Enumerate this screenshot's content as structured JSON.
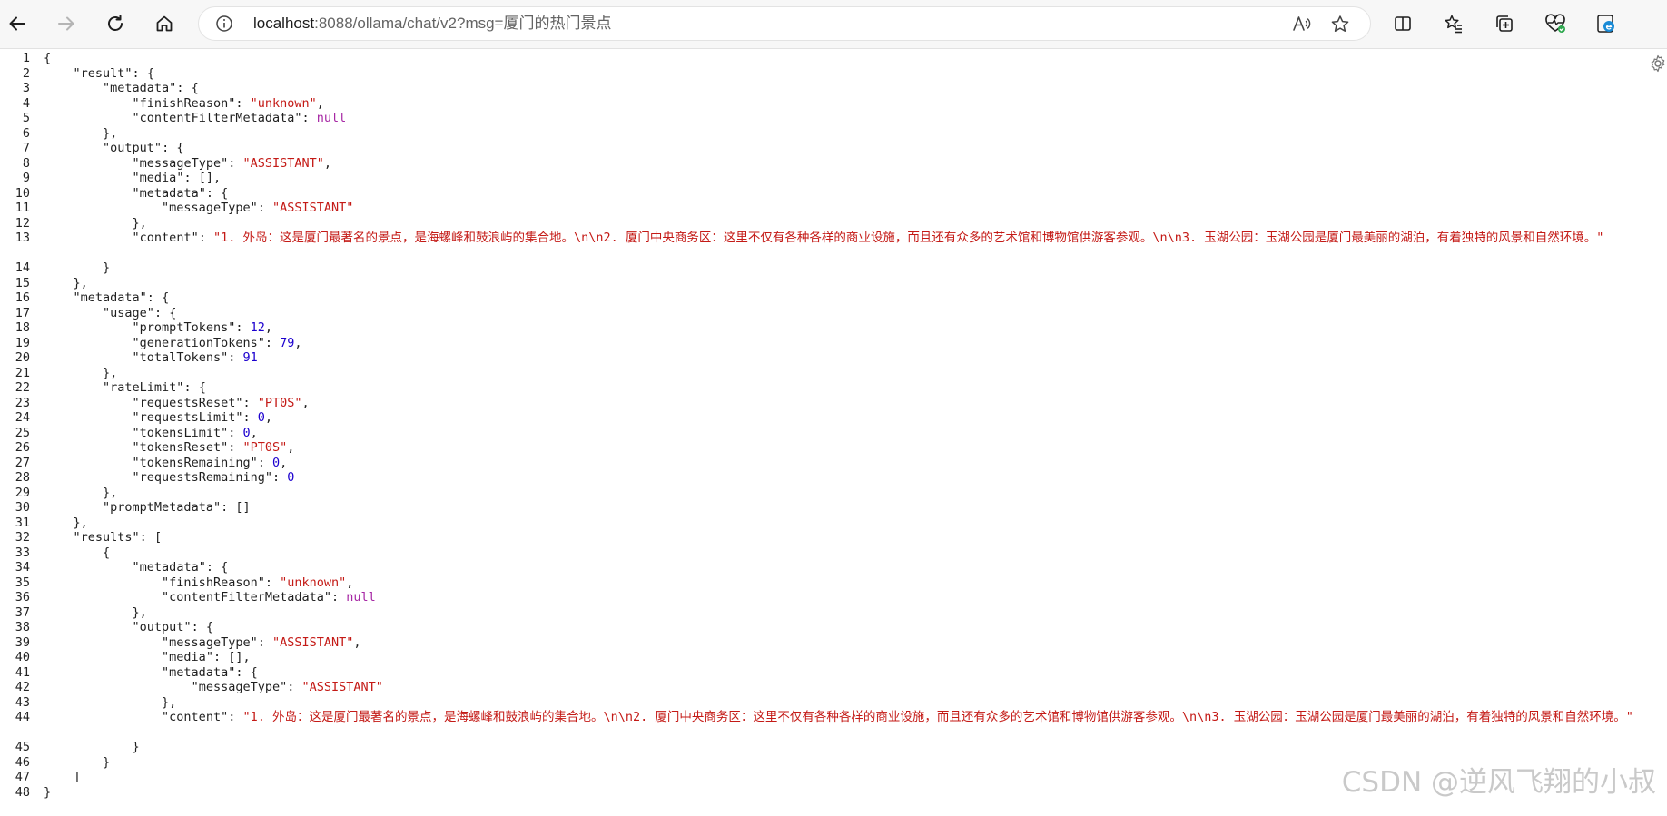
{
  "browser": {
    "url_host": "localhost",
    "url_rest": ":8088/ollama/chat/v2?msg=厦门的热门景点",
    "icons": [
      "back-icon",
      "forward-icon",
      "refresh-icon",
      "home-icon",
      "info-icon",
      "read-aloud-icon",
      "favorite-star-icon",
      "split-screen-icon",
      "favorites-icon",
      "collections-icon",
      "performance-icon",
      "edge-icon",
      "settings-gear-icon"
    ]
  },
  "watermark": "CSDN @逆风飞翔的小叔",
  "lines": [
    {
      "n": "1",
      "c": "{"
    },
    {
      "n": "2",
      "c": "    \"result\": {"
    },
    {
      "n": "3",
      "c": "        \"metadata\": {"
    },
    {
      "n": "4",
      "c": "            \"finishReason\": \"unknown\","
    },
    {
      "n": "5",
      "c": "            \"contentFilterMetadata\": null"
    },
    {
      "n": "6",
      "c": "        },"
    },
    {
      "n": "7",
      "c": "        \"output\": {"
    },
    {
      "n": "8",
      "c": "            \"messageType\": \"ASSISTANT\","
    },
    {
      "n": "9",
      "c": "            \"media\": [],"
    },
    {
      "n": "10",
      "c": "            \"metadata\": {"
    },
    {
      "n": "11",
      "c": "                \"messageType\": \"ASSISTANT\""
    },
    {
      "n": "12",
      "c": "            },"
    },
    {
      "n": "13",
      "c": "            \"content\": \"1. 外岛：这是厦门最著名的景点，是海螺峰和鼓浪屿的集合地。\\n\\n2. 厦门中央商务区：这里不仅有各种各样的商业设施，而且还有众多的艺术馆和博物馆供游客参观。\\n\\n3. 玉湖公园：玉湖公园是厦门最美丽的湖泊，有着独特的风景和自然环境。\"",
      "tall": true
    },
    {
      "n": "14",
      "c": "        }"
    },
    {
      "n": "15",
      "c": "    },"
    },
    {
      "n": "16",
      "c": "    \"metadata\": {"
    },
    {
      "n": "17",
      "c": "        \"usage\": {"
    },
    {
      "n": "18",
      "c": "            \"promptTokens\": 12,"
    },
    {
      "n": "19",
      "c": "            \"generationTokens\": 79,"
    },
    {
      "n": "20",
      "c": "            \"totalTokens\": 91"
    },
    {
      "n": "21",
      "c": "        },"
    },
    {
      "n": "22",
      "c": "        \"rateLimit\": {"
    },
    {
      "n": "23",
      "c": "            \"requestsReset\": \"PT0S\","
    },
    {
      "n": "24",
      "c": "            \"requestsLimit\": 0,"
    },
    {
      "n": "25",
      "c": "            \"tokensLimit\": 0,"
    },
    {
      "n": "26",
      "c": "            \"tokensReset\": \"PT0S\","
    },
    {
      "n": "27",
      "c": "            \"tokensRemaining\": 0,"
    },
    {
      "n": "28",
      "c": "            \"requestsRemaining\": 0"
    },
    {
      "n": "29",
      "c": "        },"
    },
    {
      "n": "30",
      "c": "        \"promptMetadata\": []"
    },
    {
      "n": "31",
      "c": "    },"
    },
    {
      "n": "32",
      "c": "    \"results\": ["
    },
    {
      "n": "33",
      "c": "        {"
    },
    {
      "n": "34",
      "c": "            \"metadata\": {"
    },
    {
      "n": "35",
      "c": "                \"finishReason\": \"unknown\","
    },
    {
      "n": "36",
      "c": "                \"contentFilterMetadata\": null"
    },
    {
      "n": "37",
      "c": "            },"
    },
    {
      "n": "38",
      "c": "            \"output\": {"
    },
    {
      "n": "39",
      "c": "                \"messageType\": \"ASSISTANT\","
    },
    {
      "n": "40",
      "c": "                \"media\": [],"
    },
    {
      "n": "41",
      "c": "                \"metadata\": {"
    },
    {
      "n": "42",
      "c": "                    \"messageType\": \"ASSISTANT\""
    },
    {
      "n": "43",
      "c": "                },"
    },
    {
      "n": "44",
      "c": "                \"content\": \"1. 外岛：这是厦门最著名的景点，是海螺峰和鼓浪屿的集合地。\\n\\n2. 厦门中央商务区：这里不仅有各种各样的商业设施，而且还有众多的艺术馆和博物馆供游客参观。\\n\\n3. 玉湖公园：玉湖公园是厦门最美丽的湖泊，有着独特的风景和自然环境。\"",
      "tall": true
    },
    {
      "n": "45",
      "c": "            }"
    },
    {
      "n": "46",
      "c": "        }"
    },
    {
      "n": "47",
      "c": "    ]"
    },
    {
      "n": "48",
      "c": "}"
    }
  ]
}
